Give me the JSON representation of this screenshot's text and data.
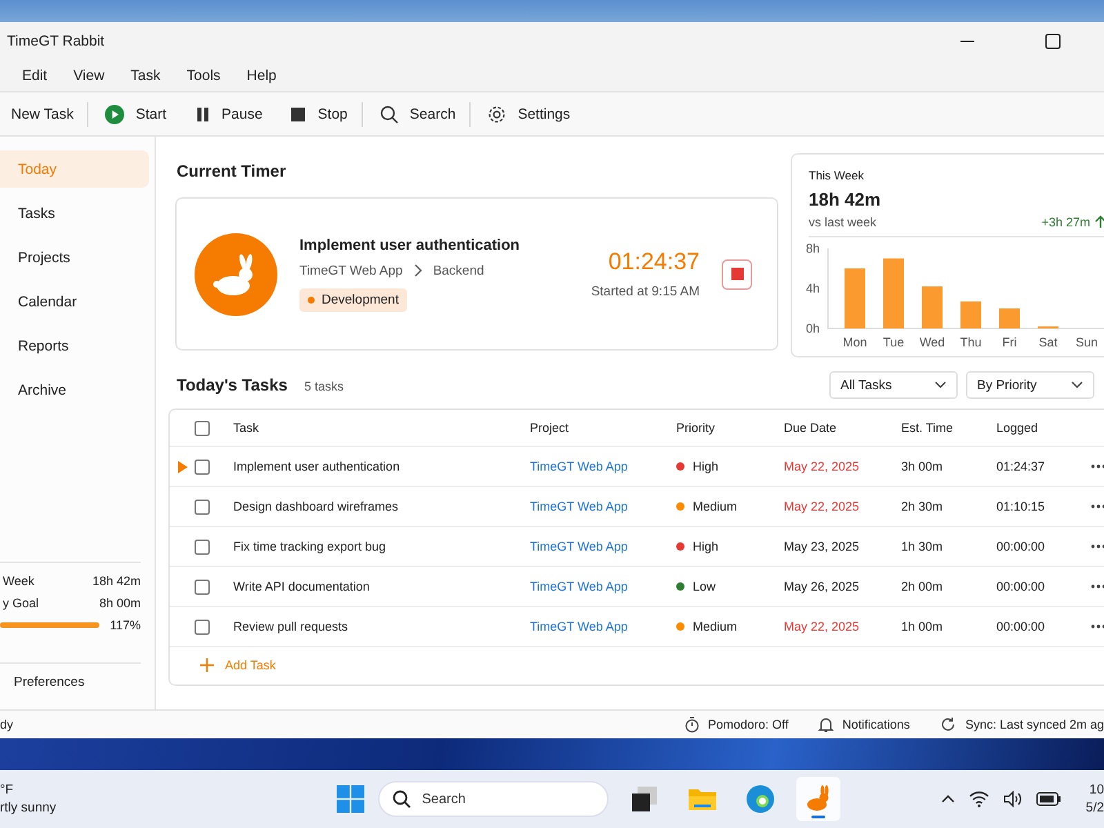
{
  "window": {
    "title": "TimeGT Rabbit"
  },
  "menu": [
    "Edit",
    "View",
    "Task",
    "Tools",
    "Help"
  ],
  "toolbar": [
    [
      {
        "label": "New Task",
        "kind": "plain"
      }
    ],
    [
      {
        "label": "Start",
        "kind": "play"
      },
      {
        "label": "Pause",
        "kind": "pause"
      },
      {
        "label": "Stop",
        "kind": "stop"
      }
    ],
    [
      {
        "label": "Search",
        "kind": "search"
      }
    ],
    [
      {
        "label": "Settings",
        "kind": "gear"
      }
    ]
  ],
  "sidebar": {
    "items": [
      {
        "label": "Today",
        "selected": true
      },
      {
        "label": "Tasks",
        "selected": false
      },
      {
        "label": "Projects",
        "selected": false
      },
      {
        "label": "Calendar",
        "selected": false
      },
      {
        "label": "Reports",
        "selected": false
      },
      {
        "label": "Archive",
        "selected": false
      }
    ],
    "stats": [
      {
        "label": "Week",
        "value": "18h 42m"
      },
      {
        "label": "y Goal",
        "value": "8h 00m"
      }
    ],
    "goal_progress": {
      "level": 1,
      "reading": "117%"
    },
    "footer": "Preferences"
  },
  "current_timer": {
    "heading": "Current Timer",
    "task": "Implement user authentication",
    "project": "TimeGT Web App",
    "subproject": "Backend",
    "tag": "Development",
    "elapsed": "01:24:37",
    "started": "Started at 9:15 AM"
  },
  "week": {
    "label": "This Week",
    "total": "18h 42m",
    "compare_label": "vs last week",
    "change": "+3h 27m",
    "chart_data": {
      "type": "bar",
      "categories": [
        "Mon",
        "Tue",
        "Wed",
        "Thu",
        "Fri",
        "Sat",
        "Sun"
      ],
      "values": [
        6,
        7,
        4.2,
        2.7,
        2,
        0.2,
        0
      ],
      "ylim": [
        0,
        8
      ],
      "yticks": [
        {
          "value": 0,
          "label": "0h"
        },
        {
          "value": 4,
          "label": "4h"
        },
        {
          "value": 8,
          "label": "8h"
        }
      ]
    }
  },
  "tasks": {
    "heading": "Today's Tasks",
    "count": "5 tasks",
    "filters": [
      "All Tasks",
      "By Priority"
    ],
    "select_all_checked": false,
    "columns": [
      "Task",
      "Project",
      "Priority",
      "Due Date",
      "Est. Time",
      "Logged"
    ],
    "rows": [
      {
        "running": true,
        "checked": false,
        "task": "Implement user authentication",
        "project": "TimeGT Web App",
        "priority": "High",
        "color": "#e53935",
        "due": "May 22, 2025",
        "overdue": true,
        "estimate": "3h 00m",
        "logged": "01:24:37"
      },
      {
        "running": false,
        "checked": false,
        "task": "Design dashboard wireframes",
        "project": "TimeGT Web App",
        "priority": "Medium",
        "color": "#fb8c00",
        "due": "May 22, 2025",
        "overdue": true,
        "estimate": "2h 30m",
        "logged": "01:10:15"
      },
      {
        "running": false,
        "checked": false,
        "task": "Fix time tracking export bug",
        "project": "TimeGT Web App",
        "priority": "High",
        "color": "#e53935",
        "due": "May 23, 2025",
        "overdue": false,
        "estimate": "1h 30m",
        "logged": "00:00:00"
      },
      {
        "running": false,
        "checked": false,
        "task": "Write API documentation",
        "project": "TimeGT Web App",
        "priority": "Low",
        "color": "#2e7d32",
        "due": "May 26, 2025",
        "overdue": false,
        "estimate": "2h 00m",
        "logged": "00:00:00"
      },
      {
        "running": false,
        "checked": false,
        "task": "Review pull requests",
        "project": "TimeGT Web App",
        "priority": "Medium",
        "color": "#fb8c00",
        "due": "May 22, 2025",
        "overdue": true,
        "estimate": "1h 00m",
        "logged": "00:00:00"
      }
    ],
    "add_label": "Add Task"
  },
  "status_bar": {
    "left": "dy",
    "items": [
      {
        "label": "Pomodoro: Off",
        "kind": "timer"
      },
      {
        "label": "Notifications",
        "kind": "bell"
      },
      {
        "label": "Sync: Last synced 2m ag",
        "kind": "sync"
      }
    ]
  },
  "taskbar": {
    "weather_temp": "°F",
    "weather_text": "rtly sunny",
    "search_placeholder": "Search",
    "apps": [
      {
        "kind": "taskview",
        "selected": false
      },
      {
        "kind": "folder",
        "selected": false
      },
      {
        "kind": "edge",
        "selected": false
      },
      {
        "kind": "rabbit",
        "selected": true
      }
    ],
    "time": "10",
    "date": "5/2"
  }
}
